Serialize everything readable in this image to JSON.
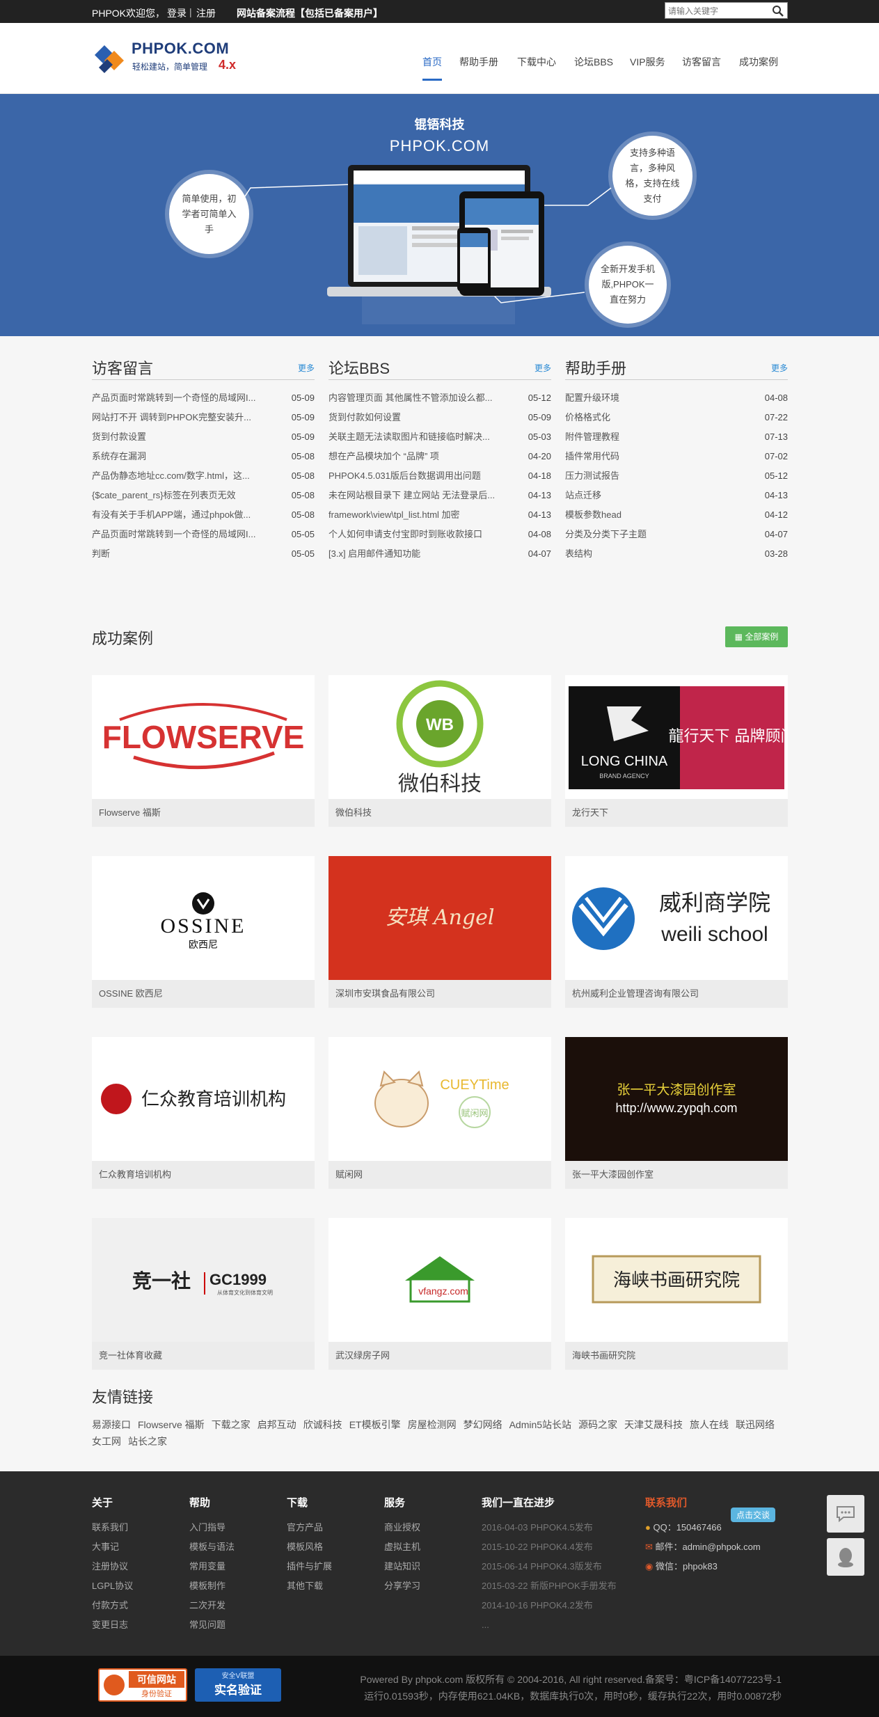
{
  "topbar": {
    "welcome": "PHPOK欢迎您，",
    "login": "登录",
    "separator": "|",
    "register": "注册",
    "beian_link": "网站备案流程【包括已备案用户】",
    "search_placeholder": "请输入关键字"
  },
  "logo": {
    "brand": "PHPOK.COM",
    "slogan": "轻松建站，简单管理",
    "version": "4.x"
  },
  "nav": [
    {
      "label": "首页",
      "active": true
    },
    {
      "label": "帮助手册"
    },
    {
      "label": "下载中心"
    },
    {
      "label": "论坛BBS"
    },
    {
      "label": "VIP服务"
    },
    {
      "label": "访客留言"
    },
    {
      "label": "成功案例"
    }
  ],
  "banner": {
    "title": "锟铻科技",
    "subtitle": "PHPOK.COM",
    "bubble_left": "简单使用，初学者可简单入手",
    "bubble_right_top": "支持多种语言，多种风格，支持在线支付",
    "bubble_right_bottom": "全新开发手机版,PHPOK一直在努力"
  },
  "columns": [
    {
      "title": "访客留言",
      "more": "更多",
      "items": [
        {
          "title": "产品页面时常跳转到一个奇怪的局域网I...",
          "date": "05-09"
        },
        {
          "title": "网站打不开 调转到PHPOK完整安装升...",
          "date": "05-09"
        },
        {
          "title": "货到付款设置",
          "date": "05-09"
        },
        {
          "title": "系统存在漏洞",
          "date": "05-08"
        },
        {
          "title": "产品伪静态地址cc.com/数字.html，这...",
          "date": "05-08"
        },
        {
          "title": "{$cate_parent_rs}标签在列表页无效",
          "date": "05-08"
        },
        {
          "title": "有没有关于手机APP端，通过phpok做...",
          "date": "05-08"
        },
        {
          "title": "产品页面时常跳转到一个奇怪的局域网I...",
          "date": "05-05"
        },
        {
          "title": "判断",
          "date": "05-05"
        }
      ]
    },
    {
      "title": "论坛BBS",
      "more": "更多",
      "items": [
        {
          "title": "内容管理页面 其他属性不管添加设么都...",
          "date": "05-12"
        },
        {
          "title": "货到付款如何设置",
          "date": "05-09"
        },
        {
          "title": "关联主题无法读取图片和链接临时解决...",
          "date": "05-03"
        },
        {
          "title": "想在产品模块加个 “品牌” 项",
          "date": "04-20"
        },
        {
          "title": "PHPOK4.5.031版后台数据调用出问题",
          "date": "04-18"
        },
        {
          "title": "未在网站根目录下 建立网站 无法登录后...",
          "date": "04-13"
        },
        {
          "title": "framework\\view\\tpl_list.html 加密",
          "date": "04-13"
        },
        {
          "title": "个人如何申请支付宝即时到账收款接口",
          "date": "04-08"
        },
        {
          "title": "[3.x] 启用邮件通知功能",
          "date": "04-07"
        }
      ]
    },
    {
      "title": "帮助手册",
      "more": "更多",
      "items": [
        {
          "title": "配置升级环境",
          "date": "04-08"
        },
        {
          "title": "价格格式化",
          "date": "07-22"
        },
        {
          "title": "附件管理教程",
          "date": "07-13"
        },
        {
          "title": "插件常用代码",
          "date": "07-02"
        },
        {
          "title": "压力测试报告",
          "date": "05-12"
        },
        {
          "title": "站点迁移",
          "date": "04-13"
        },
        {
          "title": "模板参数head",
          "date": "04-12"
        },
        {
          "title": "分类及分类下子主题",
          "date": "04-07"
        },
        {
          "title": "表结构",
          "date": "03-28"
        }
      ]
    }
  ],
  "cases": {
    "title": "成功案例",
    "all_label": "全部案例",
    "items": [
      {
        "caption": "Flowserve 福斯",
        "logo": "FLOWSERVE"
      },
      {
        "caption": "微伯科技",
        "logo": "WB",
        "logo_text": "微伯科技"
      },
      {
        "caption": "龙行天下",
        "logo": "LONG CHINA",
        "logo_sub": "BRAND AGENCY",
        "logo_text": "龍行天下 品牌顾问"
      },
      {
        "caption": "OSSINE 欧西尼",
        "logo": "OSSINE",
        "logo_text": "欧西尼"
      },
      {
        "caption": "深圳市安琪食品有限公司",
        "logo": "安琪 Angel"
      },
      {
        "caption": "杭州威利企业管理咨询有限公司",
        "logo": "威利商学院",
        "logo_sub": "weili school"
      },
      {
        "caption": "仁众教育培训机构",
        "logo": "仁众教育培训机构"
      },
      {
        "caption": "赋闲网",
        "logo": "CUEYTime",
        "logo_text": "赋闲网"
      },
      {
        "caption": "张一平大漆园创作室",
        "logo": "张一平大漆园创作室",
        "logo_sub": "http://www.zypqh.com"
      },
      {
        "caption": "竞一社体育收藏",
        "logo": "竞一社",
        "logo_sub": "GC1999",
        "logo_text": "从体育文化到体育文明"
      },
      {
        "caption": "武汉绿房子网",
        "logo": "vfangz.com"
      },
      {
        "caption": "海峡书画研究院",
        "logo": "海峡书画研究院"
      }
    ]
  },
  "links": {
    "title": "友情链接",
    "items": [
      "易源接口",
      "Flowserve 福斯",
      "下载之家",
      "启邦互动",
      "欣诚科技",
      "ET模板引擎",
      "房屋检测网",
      "梦幻网络",
      "Admin5站长站",
      "源码之家",
      "天津艾晟科技",
      "旅人在线",
      "联迅网络",
      "女工网",
      "站长之家"
    ]
  },
  "footer": {
    "about": {
      "title": "关于",
      "items": [
        "联系我们",
        "大事记",
        "注册协议",
        "LGPL协议",
        "付款方式",
        "变更日志"
      ]
    },
    "help": {
      "title": "帮助",
      "items": [
        "入门指导",
        "模板与语法",
        "常用变量",
        "模板制作",
        "二次开发",
        "常见问题"
      ]
    },
    "download": {
      "title": "下载",
      "items": [
        "官方产品",
        "模板风格",
        "插件与扩展",
        "其他下载"
      ]
    },
    "service": {
      "title": "服务",
      "items": [
        "商业授权",
        "虚拟主机",
        "建站知识",
        "分享学习"
      ]
    },
    "progress": {
      "title": "我们一直在进步",
      "items": [
        "2016-04-03 PHPOK4.5发布",
        "2015-10-22 PHPOK4.4发布",
        "2015-06-14 PHPOK4.3版发布",
        "2015-03-22 新版PHPOK手册发布",
        "2014-10-16 PHPOK4.2发布",
        "..."
      ]
    },
    "contact": {
      "title": "联系我们",
      "qq": "QQ：150467466",
      "email": "邮件：admin@phpok.com",
      "wechat": "微信：phpok83",
      "chat_badge": "点击交谈"
    }
  },
  "bottom": {
    "badge1_title": "可信网站",
    "badge1_sub": "身份验证",
    "badge2_top": "安全V联盟",
    "badge2_title": "实名验证",
    "copyright": "Powered By phpok.com 版权所有 © 2004-2016, All right reserved.备案号：粤ICP备14077223号-1",
    "runtime": "运行0.01593秒，内存使用621.04KB，数据库执行0次，用时0秒，缓存执行22次，用时0.00872秒"
  },
  "colors": {
    "banner_bg": "#3b66a8",
    "accent_blue": "#2a6ac5",
    "green_button": "#5cb85c",
    "footer_bg": "#2b2b2b",
    "contact_title": "#e0592a"
  }
}
